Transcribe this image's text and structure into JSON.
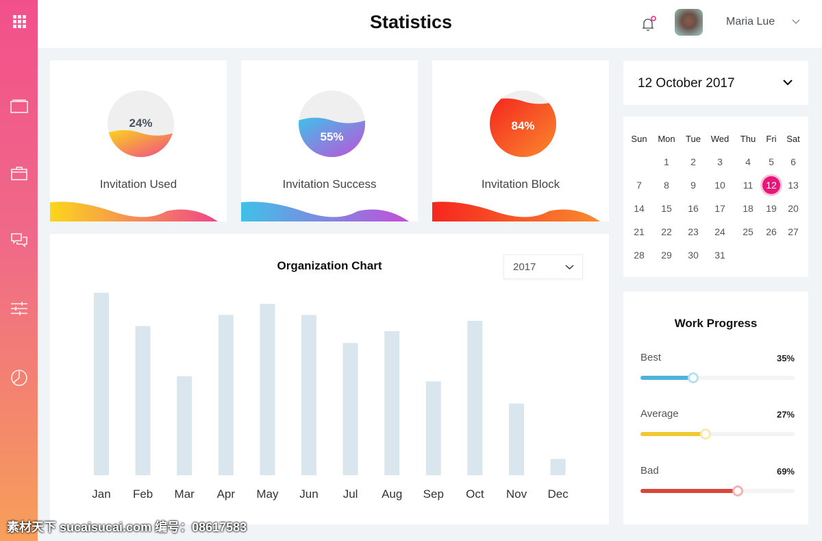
{
  "header": {
    "title": "Statistics",
    "user_name": "Maria Lue",
    "notification_icon": "bell-icon",
    "accent": "#e8157a"
  },
  "sidebar": {
    "items": [
      {
        "icon": "grid-icon"
      },
      {
        "icon": "folder-icon"
      },
      {
        "icon": "briefcase-icon"
      },
      {
        "icon": "chat-icon"
      },
      {
        "icon": "sliders-icon"
      },
      {
        "icon": "pie-chart-icon"
      }
    ]
  },
  "cards": [
    {
      "label": "Invitation Used",
      "value": "24%",
      "fraction": 0.24,
      "colors": [
        "#fbd61c",
        "#f0478a"
      ]
    },
    {
      "label": "Invitation Success",
      "value": "55%",
      "fraction": 0.55,
      "colors": [
        "#3fc1e8",
        "#c24fd8"
      ]
    },
    {
      "label": "Invitation Block",
      "value": "84%",
      "fraction": 0.84,
      "colors": [
        "#f5261f",
        "#f98a2e"
      ]
    }
  ],
  "chart_data": {
    "type": "bar",
    "title": "Organization Chart",
    "categories": [
      "Jan",
      "Feb",
      "Mar",
      "Apr",
      "May",
      "Jun",
      "Jul",
      "Aug",
      "Sep",
      "Oct",
      "Nov",
      "Dec"
    ],
    "values": [
      247,
      202,
      134,
      217,
      232,
      217,
      179,
      195,
      127,
      209,
      97,
      22
    ],
    "ylim": [
      0,
      260
    ],
    "grid": false,
    "bar_color": "#dae6ee"
  },
  "year_select": {
    "value": "2017"
  },
  "date_picker": {
    "value": "12 October 2017"
  },
  "calendar": {
    "weekdays": [
      "Sun",
      "Mon",
      "Tue",
      "Wed",
      "Thu",
      "Fri",
      "Sat"
    ],
    "weeks": [
      [
        "",
        "1",
        "2",
        "3",
        "4",
        "5",
        "6"
      ],
      [
        "7",
        "8",
        "9",
        "10",
        "11",
        "12",
        "13"
      ],
      [
        "14",
        "15",
        "16",
        "17",
        "18",
        "19",
        "20"
      ],
      [
        "21",
        "22",
        "23",
        "24",
        "25",
        "26",
        "27"
      ],
      [
        "28",
        "29",
        "30",
        "31",
        "",
        "",
        ""
      ]
    ],
    "selected": "12"
  },
  "work_progress": {
    "title": "Work Progress",
    "items": [
      {
        "label": "Best",
        "value": "35%",
        "fill": 0.34,
        "color": "#4bb3dc"
      },
      {
        "label": "Average",
        "value": "27%",
        "fill": 0.42,
        "color": "#f0c832"
      },
      {
        "label": "Bad",
        "value": "69%",
        "fill": 0.63,
        "color": "#d9463a"
      }
    ]
  },
  "watermark": "素材天下 sucaisucai.com  编号：08617583"
}
